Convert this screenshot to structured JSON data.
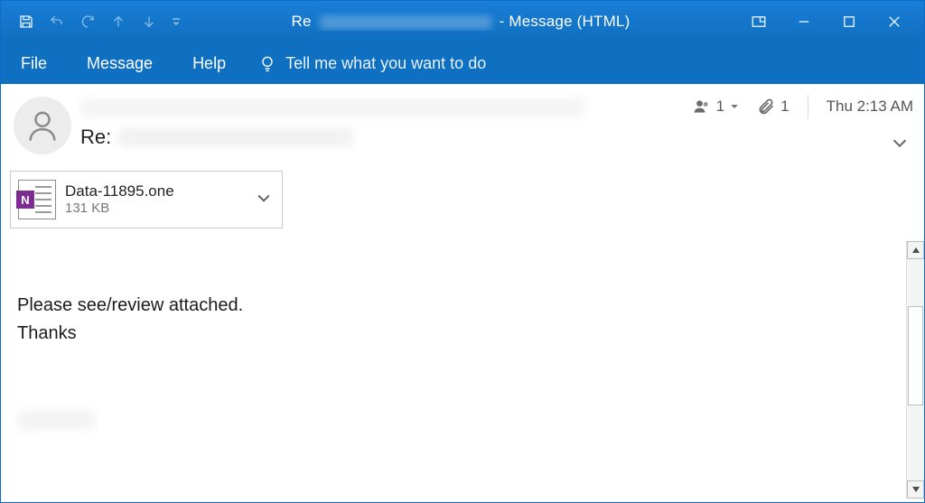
{
  "titlebar": {
    "prefix": "Re",
    "suffix": "- Message (HTML)"
  },
  "menubar": {
    "file": "File",
    "message": "Message",
    "help": "Help",
    "tell_me": "Tell me what you want to do"
  },
  "header": {
    "subject_prefix": "Re:",
    "recipients_count": "1",
    "attachments_count": "1",
    "timestamp": "Thu 2:13 AM"
  },
  "attachment": {
    "name": "Data-11895.one",
    "size": "131 KB",
    "icon_letter": "N"
  },
  "body": {
    "line1": "Please see/review attached.",
    "line2": "Thanks"
  }
}
